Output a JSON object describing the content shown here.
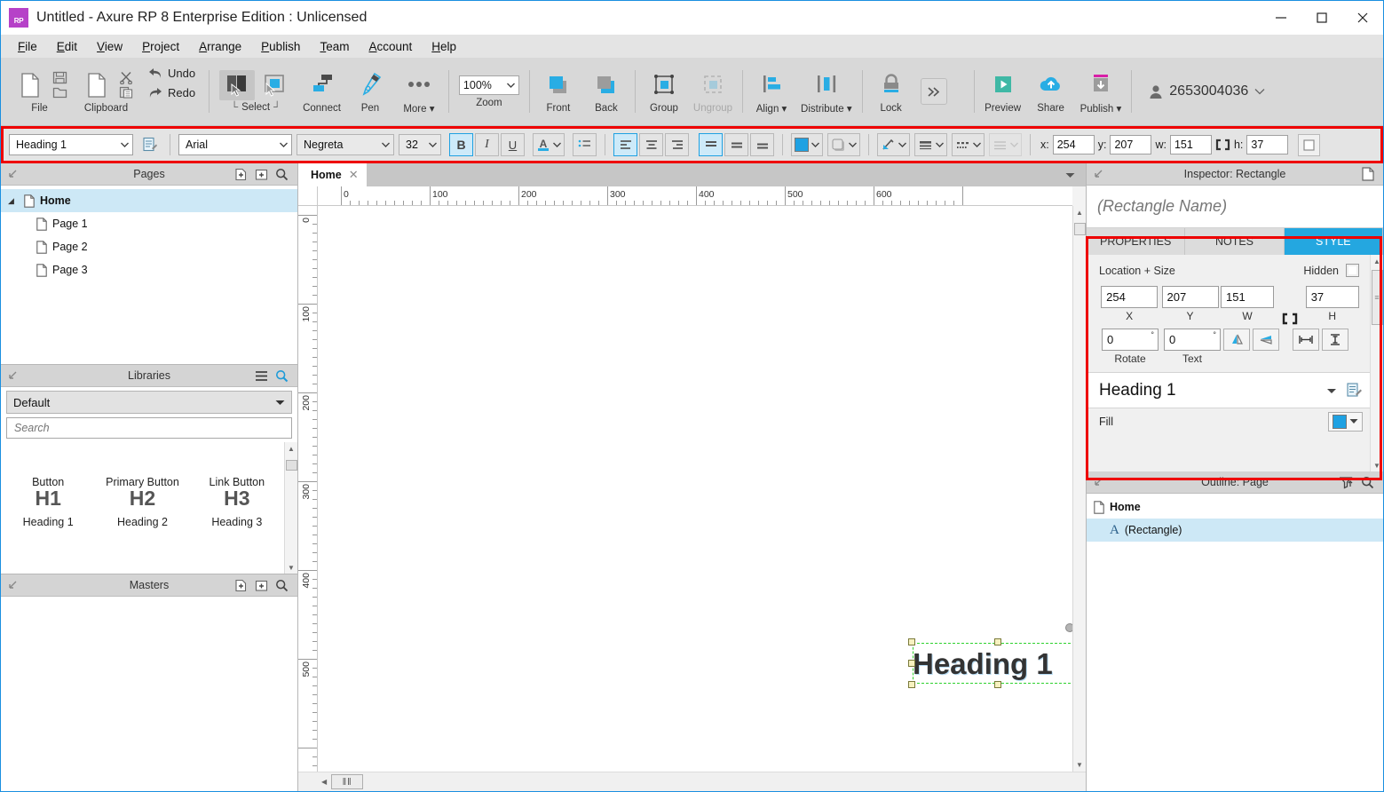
{
  "window": {
    "title": "Untitled - Axure RP 8 Enterprise Edition : Unlicensed",
    "logo_text": "RP",
    "minimize": "—",
    "maximize": "☐",
    "close": "✕"
  },
  "menubar": {
    "items": [
      "File",
      "Edit",
      "View",
      "Project",
      "Arrange",
      "Publish",
      "Team",
      "Account",
      "Help"
    ]
  },
  "ribbon": {
    "file_label": "File",
    "clipboard_label": "Clipboard",
    "undo_label": "Undo",
    "redo_label": "Redo",
    "select_label": "Select",
    "connect_label": "Connect",
    "pen_label": "Pen",
    "more_label": "More ▾",
    "zoom_value": "100%",
    "zoom_label": "Zoom",
    "front_label": "Front",
    "back_label": "Back",
    "group_label": "Group",
    "ungroup_label": "Ungroup",
    "align_label": "Align ▾",
    "distribute_label": "Distribute ▾",
    "lock_label": "Lock",
    "overflow_label": "»",
    "preview_label": "Preview",
    "share_label": "Share",
    "publish_label": "Publish ▾",
    "account_name": "2653004036",
    "account_caret": "⌄"
  },
  "formatbar": {
    "style_value": "Heading 1",
    "font_value": "Arial",
    "weight_value": "Negreta",
    "size_value": "32",
    "bold": "B",
    "italic": "I",
    "underline": "U",
    "font_color": "A",
    "x_label": "x:",
    "x_value": "254",
    "y_label": "y:",
    "y_value": "207",
    "w_label": "w:",
    "w_value": "151",
    "h_label": "h:",
    "h_value": "37"
  },
  "pages": {
    "header": "Pages",
    "tree": [
      {
        "label": "Home",
        "level": 0,
        "bold": true,
        "selected": true,
        "expander": "◢"
      },
      {
        "label": "Page 1",
        "level": 1,
        "bold": false,
        "selected": false,
        "expander": ""
      },
      {
        "label": "Page 2",
        "level": 1,
        "bold": false,
        "selected": false,
        "expander": ""
      },
      {
        "label": "Page 3",
        "level": 1,
        "bold": false,
        "selected": false,
        "expander": ""
      }
    ]
  },
  "libraries": {
    "header": "Libraries",
    "selected_library": "Default",
    "search_placeholder": "Search",
    "items": [
      {
        "label": "Button",
        "glyph": ""
      },
      {
        "label": "Primary Button",
        "glyph": ""
      },
      {
        "label": "Link Button",
        "glyph": ""
      },
      {
        "label": "Heading 1",
        "glyph": "H1"
      },
      {
        "label": "Heading 2",
        "glyph": "H2"
      },
      {
        "label": "Heading 3",
        "glyph": "H3"
      }
    ]
  },
  "masters": {
    "header": "Masters"
  },
  "canvas": {
    "tab_label": "Home",
    "tab_close": "✕",
    "h_ruler_labels": [
      "0",
      "100",
      "200",
      "300",
      "400",
      "500",
      "600"
    ],
    "v_ruler_labels": [
      "0",
      "100",
      "200",
      "300",
      "400",
      "500"
    ],
    "widget_text": "Heading 1"
  },
  "inspector": {
    "header": "Inspector: Rectangle",
    "name_placeholder": "(Rectangle Name)",
    "tabs": [
      {
        "label": "PROPERTIES",
        "active": false
      },
      {
        "label": "NOTES",
        "active": false
      },
      {
        "label": "STYLE",
        "active": true
      }
    ],
    "style": {
      "section_title": "Location + Size",
      "hidden_label": "Hidden",
      "x_value": "254",
      "x_label": "X",
      "y_value": "207",
      "y_label": "Y",
      "w_value": "151",
      "w_label": "W",
      "h_value": "37",
      "h_label": "H",
      "rotate_value": "0",
      "rotate_label": "Rotate",
      "rotate_unit": "°",
      "text_value": "0",
      "text_label": "Text",
      "text_unit": "°",
      "style_name": "Heading 1",
      "fill_label": "Fill"
    }
  },
  "outline": {
    "header": "Outline: Page",
    "items": [
      {
        "label": "Home",
        "icon": "page-icon",
        "bold": true,
        "selected": false,
        "level": 0
      },
      {
        "label": "(Rectangle)",
        "icon": "A",
        "bold": false,
        "selected": true,
        "level": 1
      }
    ]
  },
  "colors": {
    "accent_blue": "#1fa1e2",
    "tab_active_blue": "#24a7e0",
    "highlight_red": "#ee0000",
    "selection_green": "#2fd12f",
    "handle_yellow": "#f7f2c0",
    "logo_purple": "#b641c8",
    "selected_row_blue": "#cde8f6"
  }
}
